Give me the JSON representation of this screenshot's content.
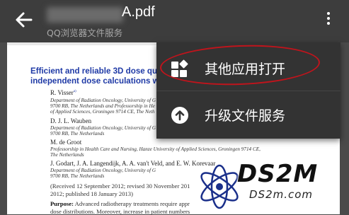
{
  "topbar": {
    "title_suffix": "A.pdf",
    "subtitle": "QQ浏览器文件服务"
  },
  "menu": {
    "items": [
      {
        "label": "其他应用打开",
        "icon": "apps-icon"
      },
      {
        "label": "升级文件服务",
        "icon": "upgrade-arrow-icon"
      }
    ],
    "highlight_color": "#c0141c"
  },
  "document": {
    "title_line1": "Efficient and reliable 3D dose qua",
    "title_line2": "independent dose calculations wi",
    "authors": [
      {
        "name": "R. Visser",
        "sup": "a)",
        "aff": [
          "Department of Radiation Oncology, University of G",
          "9700 RB, The Netherlands and Professorship in He",
          "of Applied Sciences, Groningen 9714 CE, The Neth"
        ]
      },
      {
        "name": "D. J. L. Wauben",
        "sup": "",
        "aff": [
          "Department of Radiation Oncology, University of G",
          "9700 RB, The Netherlands"
        ]
      },
      {
        "name": "M. de Groot",
        "sup": "",
        "aff": [
          "Professorship in Health Care and Nursing, Hanze University of Applied Sciences, Groningen 9714 CE,",
          "The Netherlands"
        ]
      },
      {
        "name": "J. Godart, J. A. Langendijk, A. A. van't Veld, and E. W. Korevaar",
        "sup": "",
        "aff": [
          "Department of Radiation Oncology, University of G",
          "9700 RB, The Netherlands"
        ]
      }
    ],
    "received_line1": "(Received 12 September 2012; revised 30 November 201",
    "received_line2": "2012; published 18 January 2013)",
    "purpose_label": "Purpose:",
    "purpose_line1": "Advanced radiotherapy treatments require appr",
    "purpose_line2": "dose distributions. Moreover, increase in patient numbers"
  },
  "watermark": {
    "text": "DS2M",
    "sub": "DS2m.com"
  }
}
